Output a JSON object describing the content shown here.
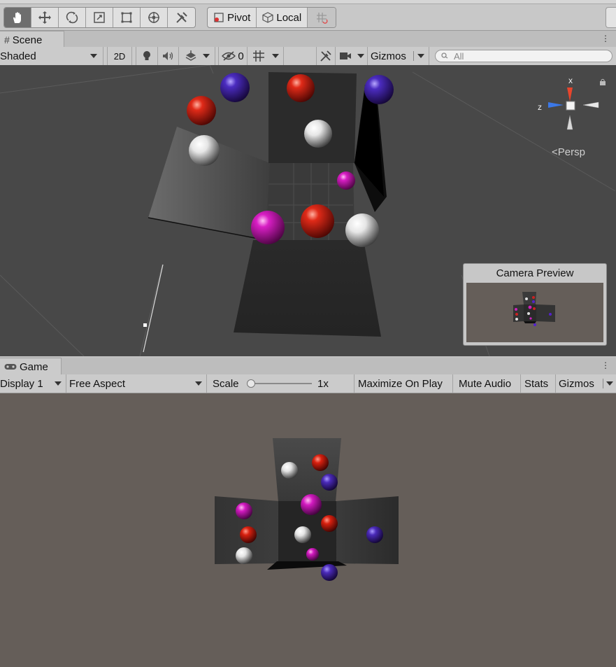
{
  "toolbar": {
    "tools": [
      "hand-tool",
      "move-tool",
      "rotate-tool",
      "scale-tool",
      "rect-tool",
      "transform-tool",
      "custom-tool"
    ],
    "pivot_label": "Pivot",
    "local_label": "Local"
  },
  "scene_tab": {
    "label": "Scene"
  },
  "scene_bar": {
    "draw_mode": "Shaded",
    "mode_2d": "2D",
    "hidden_count": "0",
    "gizmos_label": "Gizmos",
    "search_placeholder": "All"
  },
  "orientation_gizmo": {
    "x_label": "x",
    "z_label": "z",
    "projection_label": "Persp"
  },
  "camera_preview": {
    "title": "Camera Preview"
  },
  "game_tab": {
    "label": "Game"
  },
  "game_bar": {
    "display": "Display 1",
    "aspect": "Free Aspect",
    "scale_label": "Scale",
    "scale_value": "1x",
    "scale_level": 0,
    "maximize_label": "Maximize On Play",
    "mute_label": "Mute Audio",
    "stats_label": "Stats",
    "gizmos_label": "Gizmos"
  },
  "colors": {
    "red": "#cc1a10",
    "purple": "#4a2ab0",
    "magenta": "#d21ac0",
    "white": "#f0f0f0",
    "gizmo_x": "#e8452c",
    "gizmo_z": "#3b78e8",
    "game_bg": "#655e59",
    "scene_bg": "#484848"
  }
}
